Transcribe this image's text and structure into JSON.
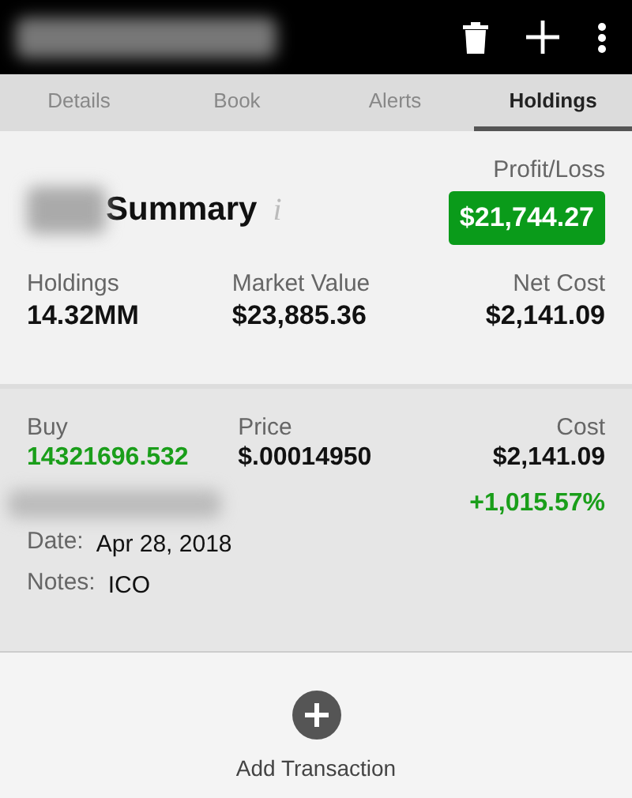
{
  "tabs": [
    {
      "label": "Details",
      "selected": false
    },
    {
      "label": "Book",
      "selected": false
    },
    {
      "label": "Alerts",
      "selected": false
    },
    {
      "label": "Holdings",
      "selected": true
    }
  ],
  "summary": {
    "title": "Summary",
    "info": "i",
    "profit_label": "Profit/Loss",
    "profit_value": "$21,744.27",
    "stats": [
      {
        "label": "Holdings",
        "value": "14.32MM"
      },
      {
        "label": "Market Value",
        "value": "$23,885.36"
      },
      {
        "label": "Net Cost",
        "value": "$2,141.09"
      }
    ]
  },
  "transactions": [
    {
      "columns": [
        {
          "label": "Buy",
          "value": "14321696.532"
        },
        {
          "label": "Price",
          "value": "$.00014950"
        },
        {
          "label": "Cost",
          "value": "$2,141.09"
        }
      ],
      "change": "+1,015.57%",
      "date_label": "Date:",
      "date": "Apr 28, 2018",
      "notes_label": "Notes:",
      "notes": "ICO"
    }
  ],
  "add_button": {
    "label": "Add Transaction"
  }
}
